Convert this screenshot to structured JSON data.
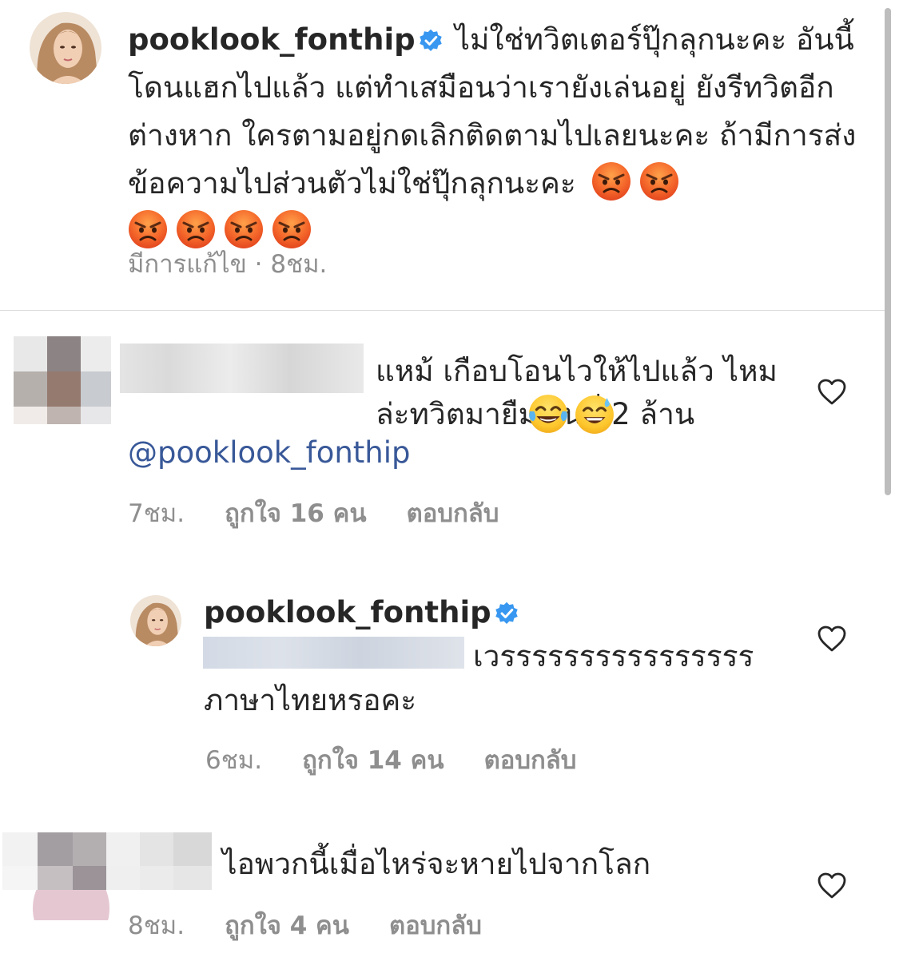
{
  "caption": {
    "username": "pooklook_fonthip",
    "text": "ไม่ใช่ทวิตเตอร์ปุ๊กลุกนะคะ อันนี้โดนแฮกไปแล้ว แต่ทำเสมือนว่าเรายังเล่นอยู่ ยังรีทวิตอีกต่างหาก ใครตามอยู่กดเลิกติดตามไปเลยนะคะ ถ้ามีการส่งข้อความไปส่วนตัวไม่ใช่ปุ๊กลุกนะคะ",
    "emoji_count": 6,
    "edited": "มีการแก้ไข · 8ชม."
  },
  "comments": [
    {
      "text": "แหม้ เกือบโอนไวให้ไปแล้ว ไหมล่ะทวิตมายืมเงินพี่ 2 ล้าน",
      "mention": "@pooklook_fonthip",
      "time": "7ชม.",
      "likes": "ถูกใจ 16 คน",
      "reply": "ตอบกลับ"
    },
    {
      "username": "pooklook_fonthip",
      "text_line1": "เวรรรรรรรรรรรรรรรร",
      "text_line2": "ภาษาไทยหรอคะ",
      "time": "6ชม.",
      "likes": "ถูกใจ 14 คน",
      "reply": "ตอบกลับ"
    },
    {
      "text": "ไอพวกนี้เมื่อไหร่จะหายไปจากโลก",
      "time": "8ชม.",
      "likes": "ถูกใจ 4 คน",
      "reply": "ตอบกลับ"
    }
  ],
  "colors": {
    "text": "#262626",
    "muted": "#8e8e8e",
    "verified": "#3897f0",
    "mention": "#385898"
  },
  "icons": [
    "verified-badge-icon",
    "angry-face-emoji",
    "tears-of-joy-emoji",
    "grinning-sweat-emoji",
    "heart-outline-icon"
  ]
}
